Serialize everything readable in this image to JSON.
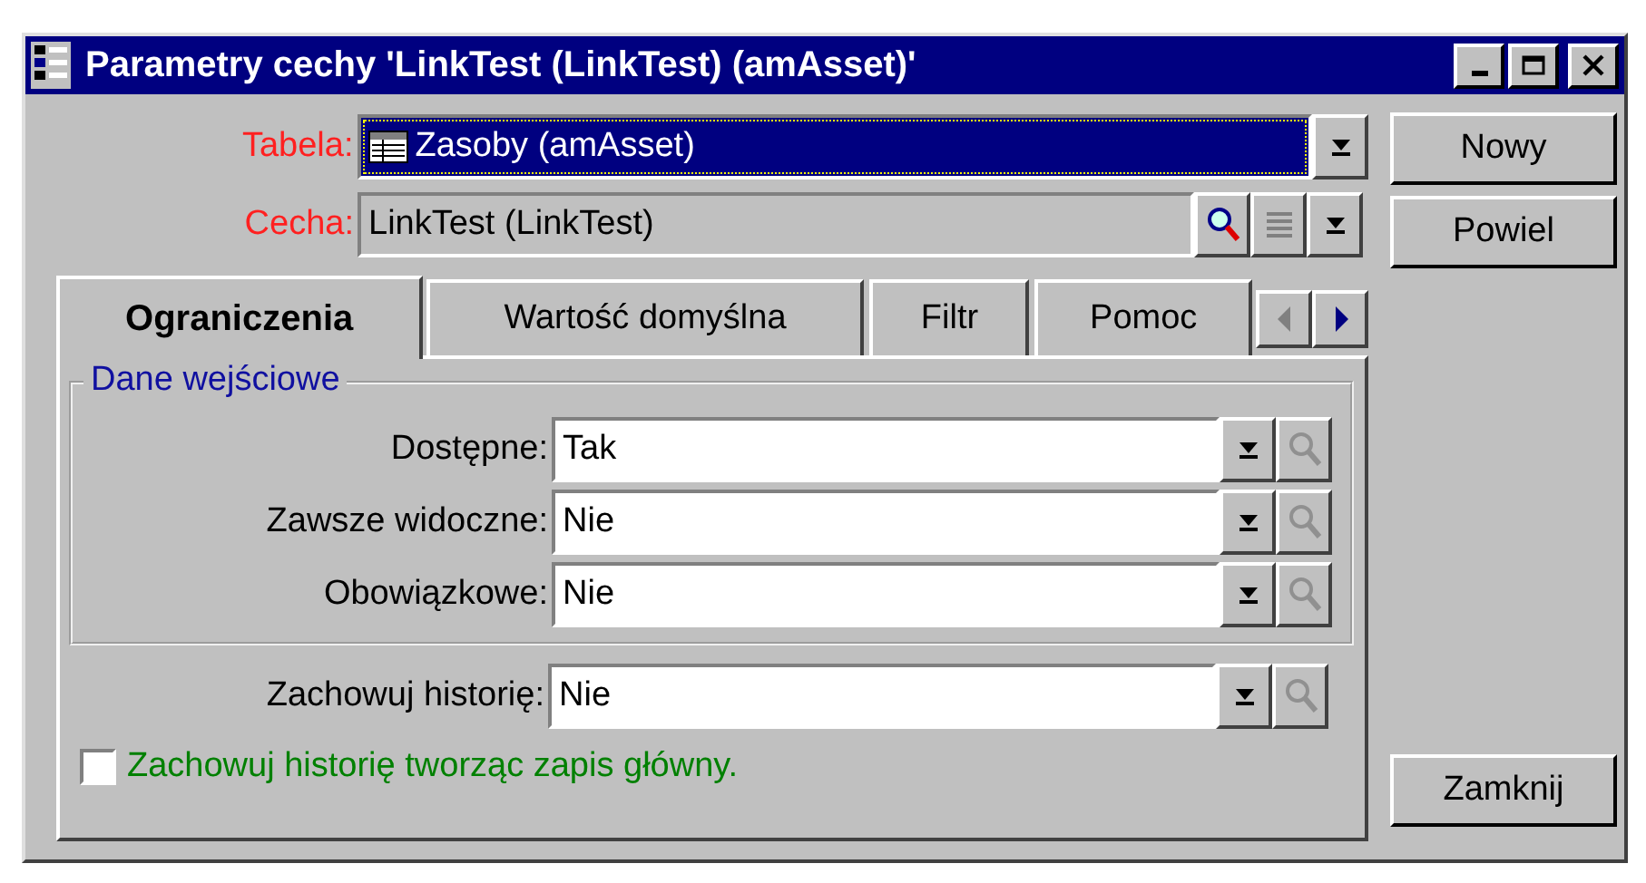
{
  "window": {
    "title": "Parametry cechy 'LinkTest (LinkTest) (amAsset)'"
  },
  "table_field": {
    "label": "Tabela:",
    "value": "Zasoby (amAsset)"
  },
  "feature_field": {
    "label": "Cecha:",
    "value": "LinkTest (LinkTest)"
  },
  "side_buttons": [
    "Nowy",
    "Powiel"
  ],
  "tabs": [
    {
      "label": "Ograniczenia",
      "selected": true
    },
    {
      "label": "Wartość domyślna",
      "selected": false
    },
    {
      "label": "Filtr",
      "selected": false
    },
    {
      "label": "Pomoc",
      "selected": false
    }
  ],
  "group": {
    "title": "Dane wejściowe",
    "rows": [
      {
        "label": "Dostępne:",
        "value": "Tak"
      },
      {
        "label": "Zawsze widoczne:",
        "value": "Nie"
      },
      {
        "label": "Obowiązkowe:",
        "value": "Nie"
      }
    ]
  },
  "history_row": {
    "label": "Zachowuj historię:",
    "value": "Nie"
  },
  "checkbox": {
    "label": "Zachowuj historię tworząc zapis główny.",
    "checked": false
  },
  "close_button": "Zamknij"
}
